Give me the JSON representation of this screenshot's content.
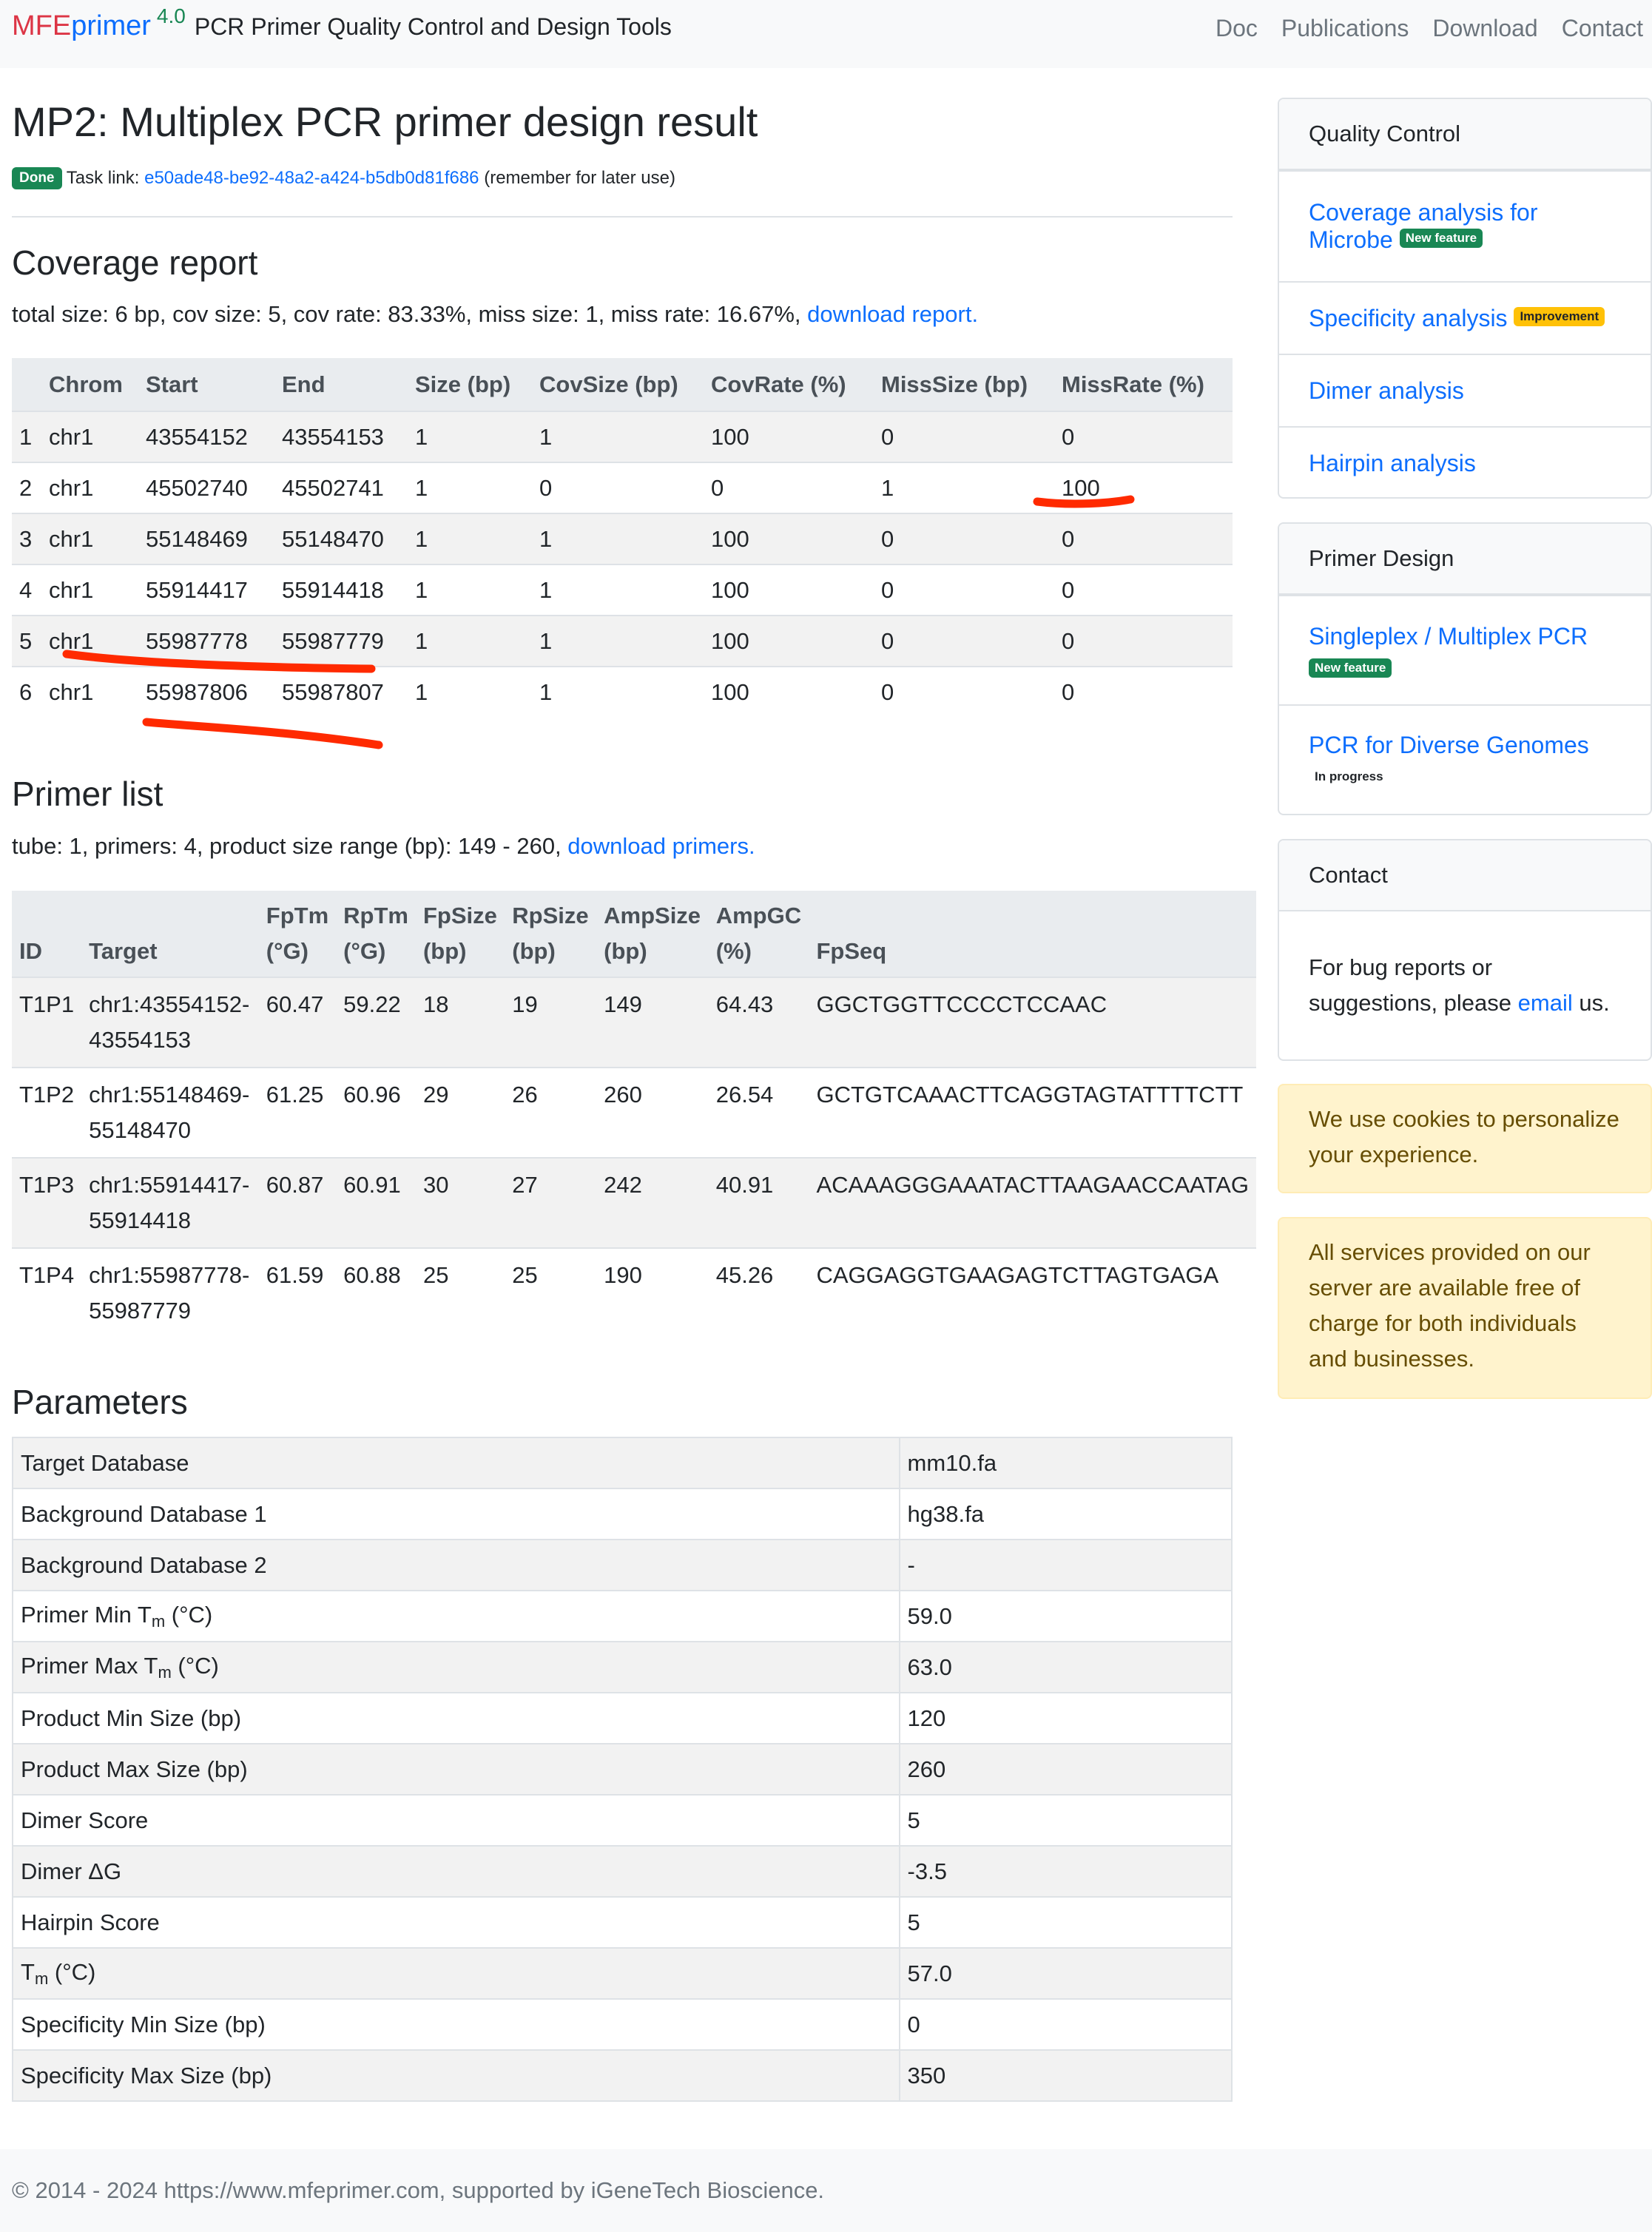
{
  "navbar": {
    "brand_mfe": "MFE",
    "brand_primer": "primer",
    "brand_version": "4.0",
    "brand_tagline": "PCR Primer Quality Control and Design Tools",
    "links": [
      "Doc",
      "Publications",
      "Download",
      "Contact"
    ]
  },
  "page": {
    "title": "MP2: Multiplex PCR primer design result",
    "status_badge": "Done",
    "task_link_label": "Task link:",
    "task_id": "e50ade48-be92-48a2-a424-b5db0d81f686",
    "task_note": "(remember for later use)"
  },
  "coverage": {
    "heading": "Coverage report",
    "summary": "total size: 6 bp, cov size: 5, cov rate: 83.33%, miss size: 1, miss rate: 16.67%,",
    "download_label": "download report.",
    "columns": [
      "",
      "Chrom",
      "Start",
      "End",
      "Size (bp)",
      "CovSize (bp)",
      "CovRate (%)",
      "MissSize (bp)",
      "MissRate (%)"
    ],
    "rows": [
      [
        "1",
        "chr1",
        "43554152",
        "43554153",
        "1",
        "1",
        "100",
        "0",
        "0"
      ],
      [
        "2",
        "chr1",
        "45502740",
        "45502741",
        "1",
        "0",
        "0",
        "1",
        "100"
      ],
      [
        "3",
        "chr1",
        "55148469",
        "55148470",
        "1",
        "1",
        "100",
        "0",
        "0"
      ],
      [
        "4",
        "chr1",
        "55914417",
        "55914418",
        "1",
        "1",
        "100",
        "0",
        "0"
      ],
      [
        "5",
        "chr1",
        "55987778",
        "55987779",
        "1",
        "1",
        "100",
        "0",
        "0"
      ],
      [
        "6",
        "chr1",
        "55987806",
        "55987807",
        "1",
        "1",
        "100",
        "0",
        "0"
      ]
    ]
  },
  "primers": {
    "heading": "Primer list",
    "summary": "tube: 1, primers: 4, product size range (bp): 149 - 260,",
    "download_label": "download primers.",
    "columns": [
      [
        "ID"
      ],
      [
        "Target"
      ],
      [
        "FpTm",
        "(°G)"
      ],
      [
        "RpTm",
        "(°G)"
      ],
      [
        "FpSize",
        "(bp)"
      ],
      [
        "RpSize",
        "(bp)"
      ],
      [
        "AmpSize",
        "(bp)"
      ],
      [
        "AmpGC",
        "(%)"
      ],
      [
        "FpSeq"
      ]
    ],
    "rows": [
      {
        "id": "T1P1",
        "target": [
          "chr1:43554152-",
          "43554153"
        ],
        "fptm": "60.47",
        "rptm": "59.22",
        "fpsize": "18",
        "rpsize": "19",
        "ampsize": "149",
        "ampgc": "64.43",
        "fpseq": "GGCTGGTTCCCCTCCAAC"
      },
      {
        "id": "T1P2",
        "target": [
          "chr1:55148469-",
          "55148470"
        ],
        "fptm": "61.25",
        "rptm": "60.96",
        "fpsize": "29",
        "rpsize": "26",
        "ampsize": "260",
        "ampgc": "26.54",
        "fpseq": "GCTGTCAAACTTCAGGTAGTATTTTCTT"
      },
      {
        "id": "T1P3",
        "target": [
          "chr1:55914417-",
          "55914418"
        ],
        "fptm": "60.87",
        "rptm": "60.91",
        "fpsize": "30",
        "rpsize": "27",
        "ampsize": "242",
        "ampgc": "40.91",
        "fpseq": "ACAAAGGGAAATACTTAAGAACCAATAG"
      },
      {
        "id": "T1P4",
        "target": [
          "chr1:55987778-",
          "55987779"
        ],
        "fptm": "61.59",
        "rptm": "60.88",
        "fpsize": "25",
        "rpsize": "25",
        "ampsize": "190",
        "ampgc": "45.26",
        "fpseq": "CAGGAGGTGAAGAGTCTTAGTGAGA"
      }
    ]
  },
  "parameters": {
    "heading": "Parameters",
    "rows": [
      {
        "label": "Target Database",
        "value": "mm10.fa"
      },
      {
        "label": "Background Database 1",
        "value": "hg38.fa"
      },
      {
        "label": "Background Database 2",
        "value": "-"
      },
      {
        "label": "Primer Min T",
        "sub": "m",
        "suffix": " (°C)",
        "value": "59.0"
      },
      {
        "label": "Primer Max T",
        "sub": "m",
        "suffix": " (°C)",
        "value": "63.0"
      },
      {
        "label": "Product Min Size (bp)",
        "value": "120"
      },
      {
        "label": "Product Max Size (bp)",
        "value": "260"
      },
      {
        "label": "Dimer Score",
        "value": "5"
      },
      {
        "label": "Dimer ΔG",
        "value": "-3.5"
      },
      {
        "label": "Hairpin Score",
        "value": "5"
      },
      {
        "label": "T",
        "sub": "m",
        "suffix": " (°C)",
        "value": "57.0"
      },
      {
        "label": "Specificity Min Size (bp)",
        "value": "0"
      },
      {
        "label": "Specificity Max Size (bp)",
        "value": "350"
      }
    ]
  },
  "sidebar": {
    "qc": {
      "header": "Quality Control",
      "items": [
        {
          "label": "Coverage analysis for",
          "label2": "Microbe",
          "badge": "New feature"
        },
        {
          "label": "Specificity analysis",
          "badge": "Improvement"
        },
        {
          "label": "Dimer analysis"
        },
        {
          "label": "Hairpin analysis"
        }
      ]
    },
    "design": {
      "header": "Primer Design",
      "items": [
        {
          "label": "Singleplex / Multiplex PCR",
          "badge": "New feature"
        },
        {
          "label": "PCR for Diverse Genomes",
          "badge": "In progress"
        }
      ]
    },
    "contact": {
      "header": "Contact",
      "text_before": "For bug reports or suggestions, please",
      "link": "email",
      "text_after": "us."
    },
    "alerts": [
      "We use cookies to personalize your experience.",
      "All services provided on our server are available free of charge for both individuals and businesses."
    ]
  },
  "footer": {
    "text": "© 2014 - 2024 https://www.mfeprimer.com, supported by iGeneTech Bioscience."
  },
  "colors": {
    "link": "#0d6efd",
    "brand_red": "#dc3545",
    "success": "#198754",
    "warning": "#ffc107",
    "annotation_red": "#ff2a00",
    "alert_bg": "#fff3cd"
  }
}
